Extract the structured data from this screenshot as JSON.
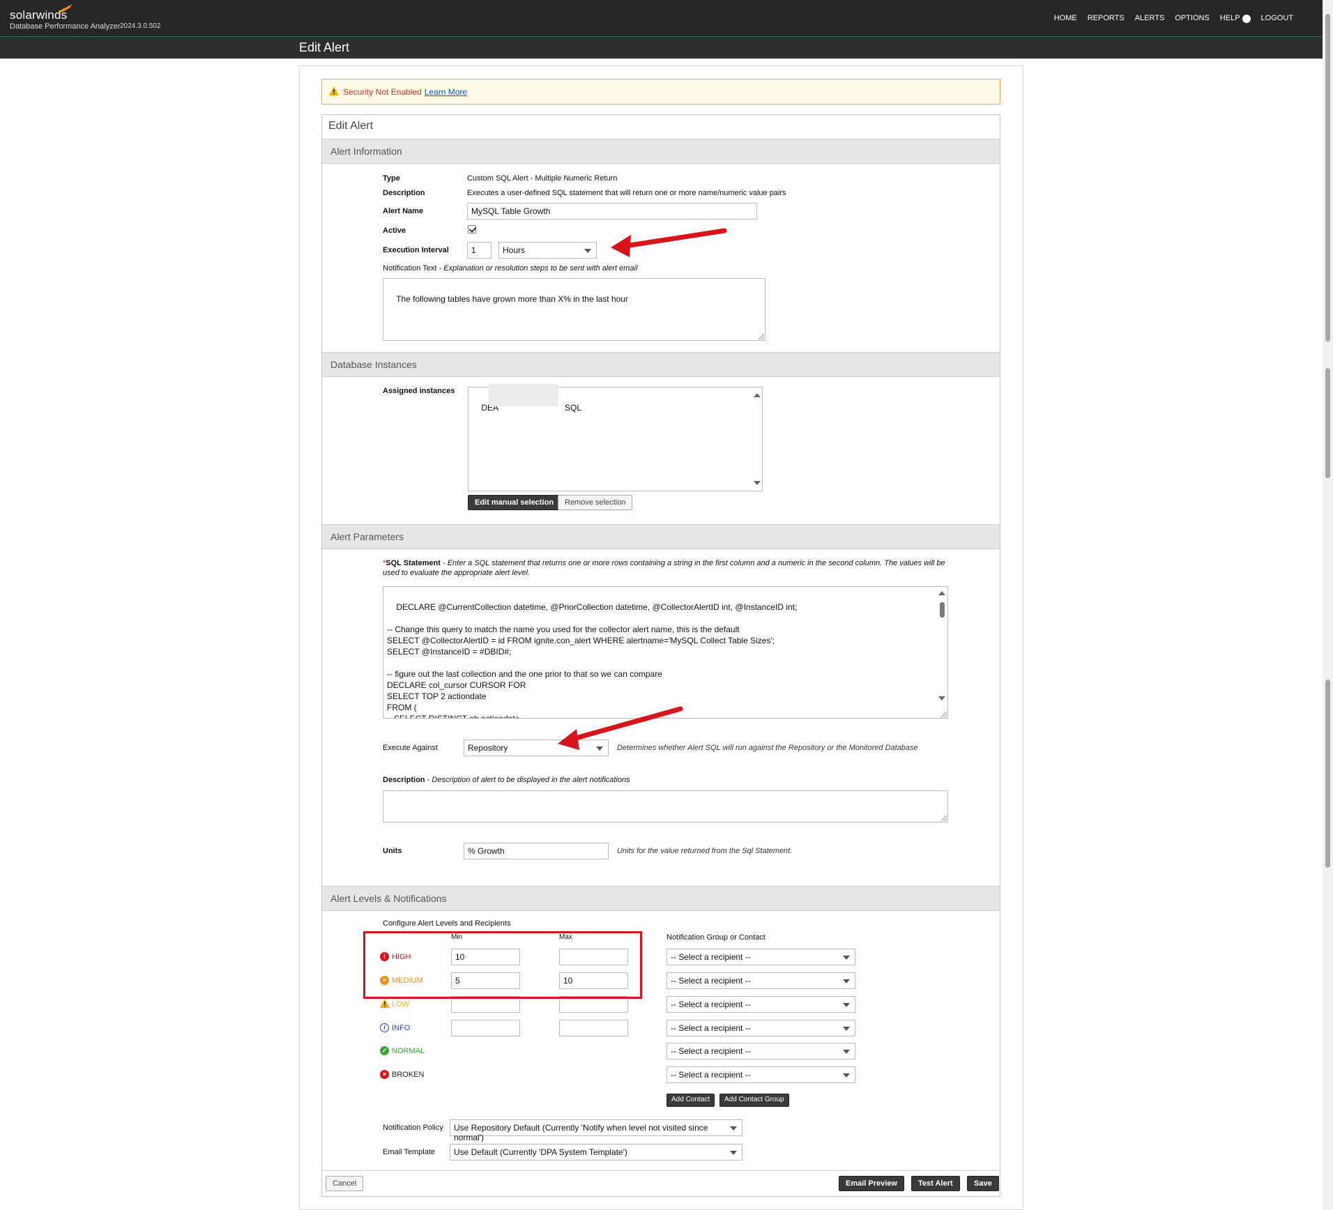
{
  "app": {
    "brand": "solarwinds",
    "product": "Database Performance Analyzer",
    "version": "2024.3.0.502",
    "nav": {
      "home": "HOME",
      "reports": "REPORTS",
      "alerts": "ALERTS",
      "options": "OPTIONS",
      "help": "HELP",
      "logout": "LOGOUT"
    },
    "page_title": "Edit Alert"
  },
  "warning": {
    "text": "Security Not Enabled",
    "link": "Learn More"
  },
  "card_title": "Edit Alert",
  "alert_info": {
    "header": "Alert Information",
    "type_label": "Type",
    "type_value": "Custom SQL Alert - Multiple Numeric Return",
    "description_label": "Description",
    "description_value": "Executes a user-defined SQL statement that will return one or more name/numeric value pairs",
    "alert_name_label": "Alert Name",
    "alert_name_value": "MySQL Table Growth",
    "active_label": "Active",
    "active_checked": true,
    "exec_interval_label": "Execution Interval",
    "exec_interval_value": "1",
    "exec_interval_unit": "Hours",
    "notif_label": "Notification Text",
    "notif_hint": " - Explanation or resolution steps to be sent with alert email",
    "notif_value": "The following tables have grown more than X% in the last hour"
  },
  "db_instances": {
    "header": "Database Instances",
    "assigned_label": "Assigned instances",
    "instance_prefix": "DEA",
    "instance_suffix": "SQL",
    "edit_button": "Edit manual selection",
    "remove_button": "Remove selection"
  },
  "alert_params": {
    "header": "Alert Parameters",
    "required_mark": "*",
    "sql_label": "SQL Statement",
    "sql_hint": " - Enter a SQL statement that returns one or more rows containing a string in the first column and a numeric in the second column. The values will be used to evaluate the appropriate alert level.",
    "sql_value": "DECLARE @CurrentCollection datetime, @PriorCollection datetime, @CollectorAlertID int, @InstanceID int;\n\n-- Change this query to match the name you used for the collector alert name, this is the default\nSELECT @CollectorAlertID = id FROM ignite.con_alert WHERE alertname='MySQL Collect Table Sizes';\nSELECT @InstanceID = #DBID#;\n\n-- figure out the last collection and the one prior to that so we can compare\nDECLARE col_cursor CURSOR FOR\nSELECT TOP 2 actiondate\nFROM (\n   SELECT DISTINCT ah.actiondate\n   FROM ignite.con_alert a",
    "execute_against_label": "Execute Against",
    "execute_against_value": "Repository",
    "execute_against_hint": "Determines whether Alert SQL will run against the Repository or the Monitored Database",
    "description_label": "Description",
    "description_hint": " - Description of alert to be displayed in the alert notifications",
    "description_value": "",
    "units_label": "Units",
    "units_value": "% Growth",
    "units_hint": "Units for the value returned from the Sql Statement."
  },
  "alert_levels": {
    "header": "Alert Levels & Notifications",
    "configure_label": "Configure Alert Levels and Recipients",
    "min_label": "Min",
    "max_label": "Max",
    "recipient_header": "Notification Group or Contact",
    "levels": [
      {
        "name": "HIGH",
        "min": "10",
        "max": "",
        "recipient": "-- Select a recipient --",
        "color": "#d9131b",
        "icon": "exclamation-icon"
      },
      {
        "name": "MEDIUM",
        "min": "5",
        "max": "10",
        "recipient": "-- Select a recipient --",
        "color": "#f08c1a",
        "icon": "x-circle-icon"
      },
      {
        "name": "LOW",
        "min": "",
        "max": "",
        "recipient": "-- Select a recipient --",
        "color": "#f2b400",
        "icon": "warning-icon"
      },
      {
        "name": "INFO",
        "min": "",
        "max": "",
        "recipient": "-- Select a recipient --",
        "color": "#2840c8",
        "icon": "info-icon"
      },
      {
        "name": "NORMAL",
        "recipient": "-- Select a recipient --",
        "color": "#3aa635",
        "icon": "check-icon"
      },
      {
        "name": "BROKEN",
        "recipient": "-- Select a recipient --",
        "color": "#222222",
        "icon": "broken-icon"
      }
    ],
    "add_contact": "Add Contact",
    "add_contact_group": "Add Contact Group",
    "policy_label": "Notification Policy",
    "policy_value": "Use Repository Default (Currently 'Notify when level not visited since normal')",
    "template_label": "Email Template",
    "template_value": "Use Default (Currently 'DPA System Template')"
  },
  "footer": {
    "cancel": "Cancel",
    "email_preview": "Email Preview",
    "test_alert": "Test Alert",
    "save": "Save"
  }
}
